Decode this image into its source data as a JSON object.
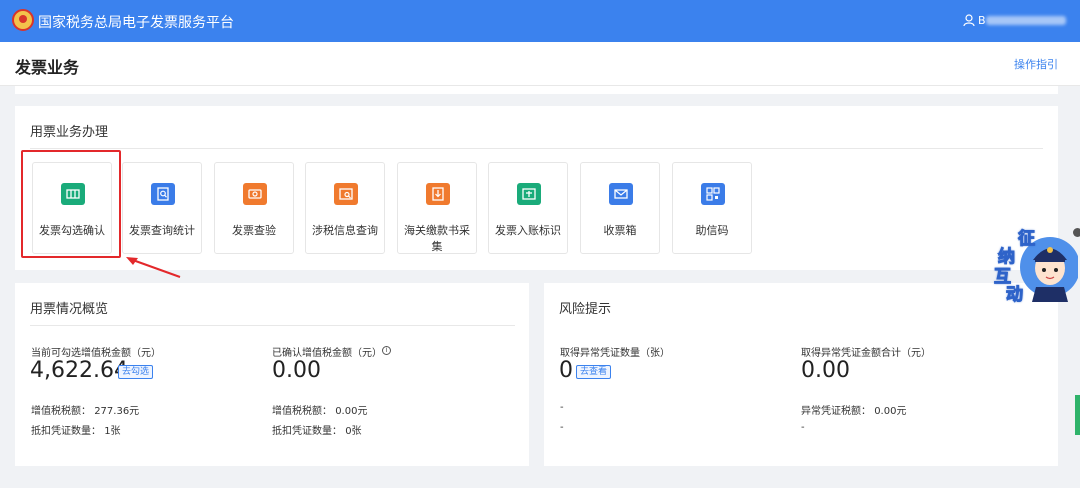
{
  "header": {
    "app_title": "国家税务总局电子发票服务平台",
    "user_prefix": "B",
    "brand_color": "#3b82ee"
  },
  "page": {
    "title": "发票业务",
    "guide_link": "操作指引"
  },
  "business": {
    "title": "用票业务办理",
    "tiles": [
      {
        "label": "发票勾选确认",
        "icon": "ticket-icon",
        "color": "#1aab7a"
      },
      {
        "label": "发票查询统计",
        "icon": "doc-search-icon",
        "color": "#3b7ce8"
      },
      {
        "label": "发票查验",
        "icon": "ticket-check-icon",
        "color": "#f07a2e"
      },
      {
        "label": "涉税信息查询",
        "icon": "info-search-icon",
        "color": "#f07a2e"
      },
      {
        "label": "海关缴款书采集",
        "icon": "customs-doc-icon",
        "color": "#f07a2e"
      },
      {
        "label": "发票入账标识",
        "icon": "invoice-tag-icon",
        "color": "#1aab7a"
      },
      {
        "label": "收票箱",
        "icon": "mailbox-icon",
        "color": "#3b7ce8"
      },
      {
        "label": "助信码",
        "icon": "qrcode-icon",
        "color": "#3b7ce8"
      }
    ]
  },
  "overview": {
    "title": "用票情况概览",
    "left": {
      "label": "当前可勾选增值税金额（元）",
      "value": "4,622.64",
      "tag": "去勾选",
      "tax_label": "增值税税额：",
      "tax_value": "277.36元",
      "count_label": "抵扣凭证数量：",
      "count_value": "1张"
    },
    "right": {
      "label": "已确认增值税金额（元）",
      "value": "0.00",
      "tax_label": "增值税税额：",
      "tax_value": "0.00元",
      "count_label": "抵扣凭证数量：",
      "count_value": "0张"
    }
  },
  "risk": {
    "title": "风险提示",
    "left": {
      "label": "取得异常凭证数量（张）",
      "value": "0",
      "tag": "去查看",
      "line1": "-",
      "line2": "-"
    },
    "right": {
      "label": "取得异常凭证金额合计（元）",
      "value": "0.00",
      "tax_label": "异常凭证税额：",
      "tax_value": "0.00元",
      "line2": "-"
    }
  },
  "mascot": {
    "chars": [
      "征",
      "纳",
      "互",
      "动"
    ]
  }
}
